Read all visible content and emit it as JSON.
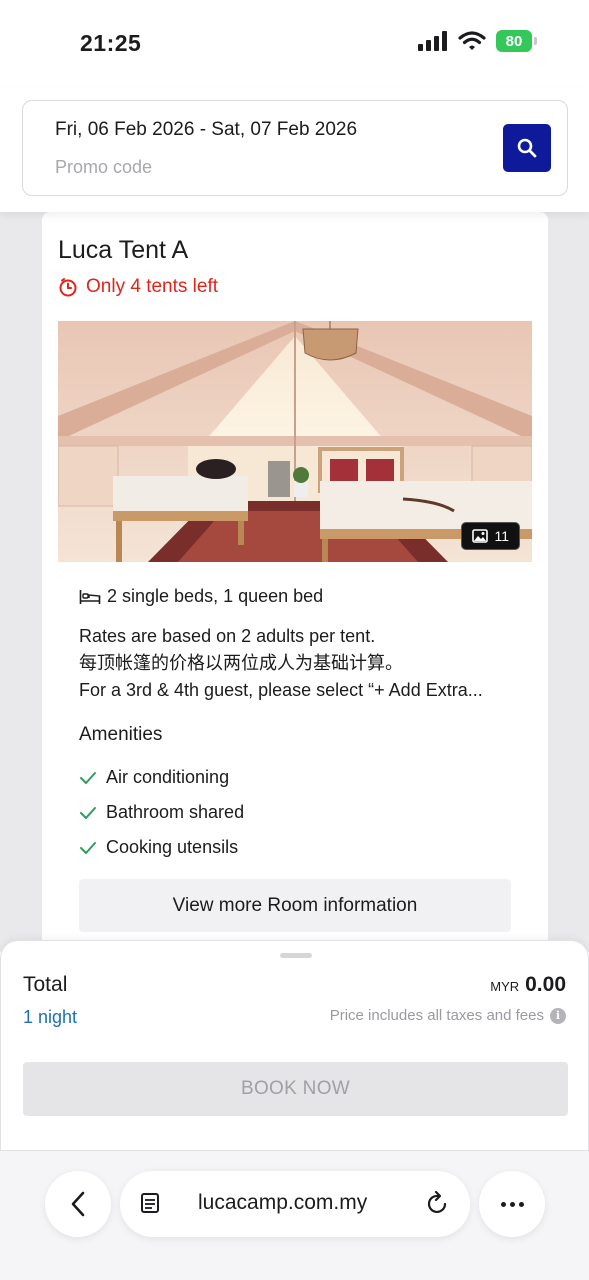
{
  "status_bar": {
    "time": "21:25",
    "battery": "80",
    "icons": [
      "signal-icon",
      "wifi-icon",
      "battery-icon"
    ]
  },
  "search": {
    "date_range": "Fri, 06 Feb 2026 - Sat, 07 Feb 2026",
    "promo_placeholder": "Promo code",
    "search_icon": "search-icon",
    "accent_color": "#0f1a9a"
  },
  "room": {
    "name": "Luca Tent A",
    "availability": "Only 4 tents left",
    "availability_icon": "timer-icon",
    "availability_color": "#e0251b",
    "photo_count": "11",
    "beds": "2 single beds, 1 queen bed",
    "description": [
      "Rates are based on 2 adults per tent.",
      "每顶帐篷的价格以两位成人为基础计算。",
      "For a 3rd & 4th guest, please select “+ Add Extra..."
    ],
    "amenities_title": "Amenities",
    "amenities": [
      "Air conditioning",
      "Bathroom shared",
      "Cooking utensils"
    ],
    "amenity_icon": "check-icon",
    "more_info_label": "View more Room information"
  },
  "summary": {
    "total_label": "Total",
    "nights": "1 night",
    "currency": "MYR",
    "amount": "0.00",
    "tax_note": "Price includes all taxes and fees",
    "book_label": "BOOK NOW",
    "nights_color": "#1d6fb8"
  },
  "browser": {
    "url": "lucacamp.com.my"
  }
}
